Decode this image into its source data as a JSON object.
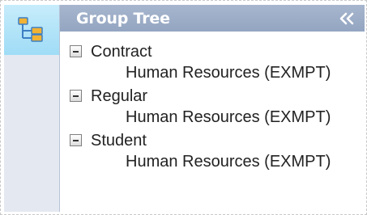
{
  "panel": {
    "title": "Group Tree",
    "collapse_icon": "double-chevron-left-icon",
    "sidebar_icon": "tree-hierarchy-icon"
  },
  "colors": {
    "header_bg": "#9aabc7",
    "sidebar_bg": "#e4e9f1",
    "sidebar_tile_bg": "#b3e4f8",
    "icon_orange": "#f2b233",
    "icon_blue": "#3d7fc4"
  },
  "tree": {
    "groups": [
      {
        "label": "Contract",
        "expanded": true,
        "children": [
          "Human Resources (EXMPT)"
        ]
      },
      {
        "label": "Regular",
        "expanded": true,
        "children": [
          "Human Resources (EXMPT)"
        ]
      },
      {
        "label": "Student",
        "expanded": true,
        "children": [
          "Human Resources (EXMPT)"
        ]
      }
    ]
  }
}
